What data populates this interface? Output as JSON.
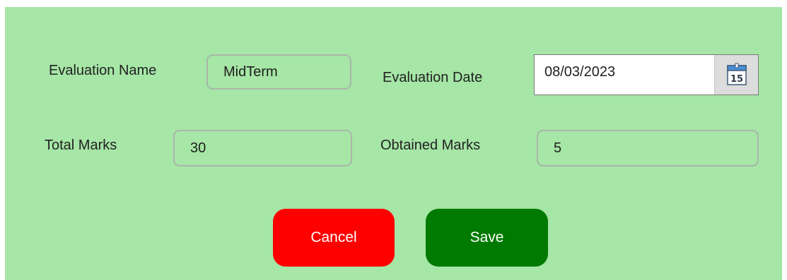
{
  "form": {
    "evaluation_name_label": "Evaluation Name",
    "evaluation_name_value": "MidTerm",
    "evaluation_date_label": "Evaluation Date",
    "evaluation_date_value": "08/03/2023",
    "total_marks_label": "Total Marks",
    "total_marks_value": "30",
    "obtained_marks_label": "Obtained Marks",
    "obtained_marks_value": "5"
  },
  "calendar_icon": {
    "name": "calendar-icon",
    "day": "15"
  },
  "buttons": {
    "cancel_label": "Cancel",
    "save_label": "Save"
  },
  "colors": {
    "background": "#a6e6a6",
    "cancel": "#ff0000",
    "save": "#007a00"
  }
}
